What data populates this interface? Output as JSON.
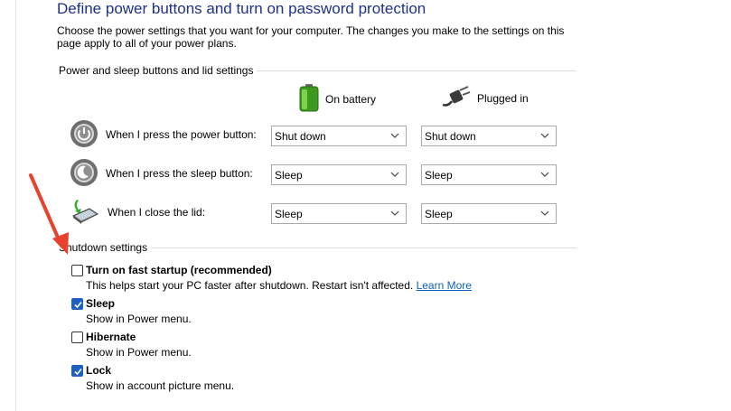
{
  "header": {
    "title": "Define power buttons and turn on password protection",
    "intro": "Choose the power settings that you want for your computer. The changes you make to the settings on this page apply to all of your power plans."
  },
  "power_section": {
    "heading": "Power and sleep buttons and lid settings",
    "columns": {
      "battery": "On battery",
      "plugged": "Plugged in"
    },
    "rows": [
      {
        "label": "When I press the power button:",
        "icon": "power-button-icon",
        "battery": "Shut down",
        "plugged": "Shut down"
      },
      {
        "label": "When I press the sleep button:",
        "icon": "sleep-button-icon",
        "battery": "Sleep",
        "plugged": "Sleep"
      },
      {
        "label": "When I close the lid:",
        "icon": "laptop-lid-icon",
        "battery": "Sleep",
        "plugged": "Sleep"
      }
    ]
  },
  "shutdown_section": {
    "heading": "Shutdown settings",
    "items": [
      {
        "title": "Turn on fast startup (recommended)",
        "desc": "This helps start your PC faster after shutdown. Restart isn't affected.",
        "link": "Learn More",
        "checked": false
      },
      {
        "title": "Sleep",
        "desc": "Show in Power menu.",
        "checked": true
      },
      {
        "title": "Hibernate",
        "desc": "Show in Power menu.",
        "checked": false
      },
      {
        "title": "Lock",
        "desc": "Show in account picture menu.",
        "checked": true
      }
    ]
  },
  "colors": {
    "title": "#1e3287",
    "link": "#1060c0",
    "checkbox": "#1f5fc4",
    "annotation_arrow": "#e8412e"
  }
}
